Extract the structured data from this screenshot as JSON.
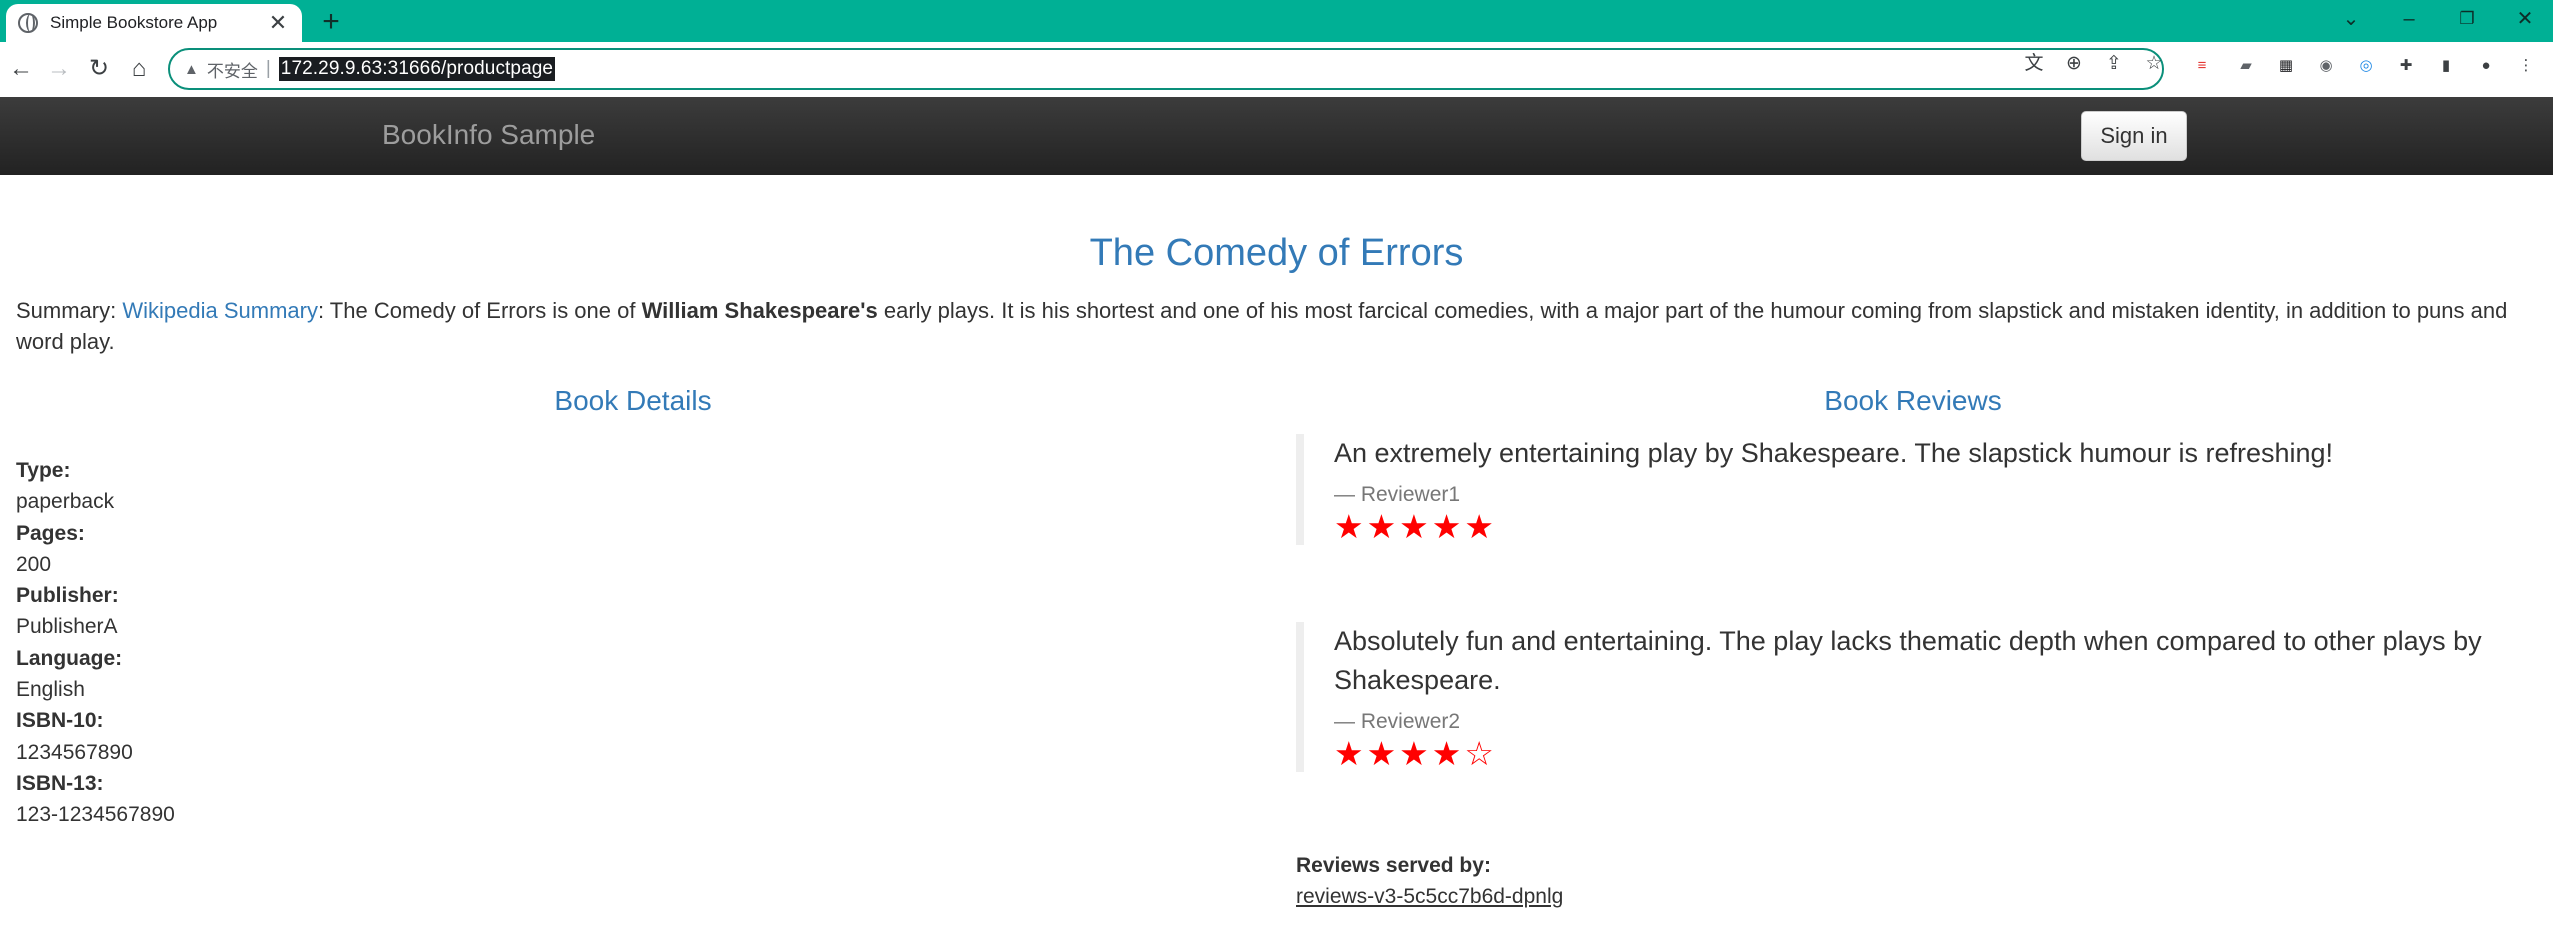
{
  "browser": {
    "tab_title": "Simple Bookstore App",
    "tab_close": "✕",
    "new_tab": "+",
    "back": "←",
    "forward": "→",
    "reload": "↻",
    "home": "⌂",
    "security_icon": "▲",
    "security_label": "不安全",
    "security_separator": "|",
    "url": "172.29.9.63:31666/productpage",
    "window_controls": {
      "chevron": "⌄",
      "minimize": "–",
      "restore": "❐",
      "close": "✕"
    },
    "omnibox_icons": {
      "translate": "文",
      "zoom": "⊕",
      "share": "⇪",
      "bookmark": "☆"
    },
    "extensions": [
      {
        "name": "ext-red-icon",
        "glyph": "≡",
        "color": "#e53935"
      },
      {
        "name": "ext-chat-icon",
        "glyph": "▰",
        "color": "#5f6368"
      },
      {
        "name": "ext-badge-icon",
        "glyph": "▦",
        "color": "#202124"
      },
      {
        "name": "ext-camera-icon",
        "glyph": "◉",
        "color": "#5f6368"
      },
      {
        "name": "ext-blue-icon",
        "glyph": "◎",
        "color": "#1e88e5"
      },
      {
        "name": "extensions-puzzle-icon",
        "glyph": "✚",
        "color": "#3c4043"
      },
      {
        "name": "side-panel-icon",
        "glyph": "▮",
        "color": "#3c4043"
      },
      {
        "name": "profile-icon",
        "glyph": "●",
        "color": "#3c4043"
      },
      {
        "name": "menu-kebab-icon",
        "glyph": "⋮",
        "color": "#3c4043"
      }
    ]
  },
  "navbar": {
    "brand": "BookInfo Sample",
    "sign_in": "Sign in"
  },
  "book": {
    "title": "The Comedy of Errors",
    "summary_prefix": "Summary: ",
    "summary_link": "Wikipedia Summary",
    "summary_text_1": ": The Comedy of Errors is one of ",
    "summary_bold": "William Shakespeare's",
    "summary_text_2": " early plays. It is his shortest and one of his most farcical comedies, with a major part of the humour coming from slapstick and mistaken identity, in addition to puns and word play."
  },
  "details": {
    "heading": "Book Details",
    "items": [
      {
        "label": "Type:",
        "value": "paperback"
      },
      {
        "label": "Pages:",
        "value": "200"
      },
      {
        "label": "Publisher:",
        "value": "PublisherA"
      },
      {
        "label": "Language:",
        "value": "English"
      },
      {
        "label": "ISBN-10:",
        "value": "1234567890"
      },
      {
        "label": "ISBN-13:",
        "value": "123-1234567890"
      }
    ]
  },
  "reviews": {
    "heading": "Book Reviews",
    "items": [
      {
        "text": "An extremely entertaining play by Shakespeare. The slapstick humour is refreshing!",
        "reviewer": "— Reviewer1",
        "rating": 5,
        "stars": "★★★★★"
      },
      {
        "text": "Absolutely fun and entertaining. The play lacks thematic depth when compared to other plays by Shakespeare.",
        "reviewer": "— Reviewer2",
        "rating": 4,
        "stars": "★★★★☆"
      }
    ],
    "served_label": "Reviews served by:",
    "served_pod": "reviews-v3-5c5cc7b6d-dpnlg",
    "star_color": "#ff0000"
  }
}
